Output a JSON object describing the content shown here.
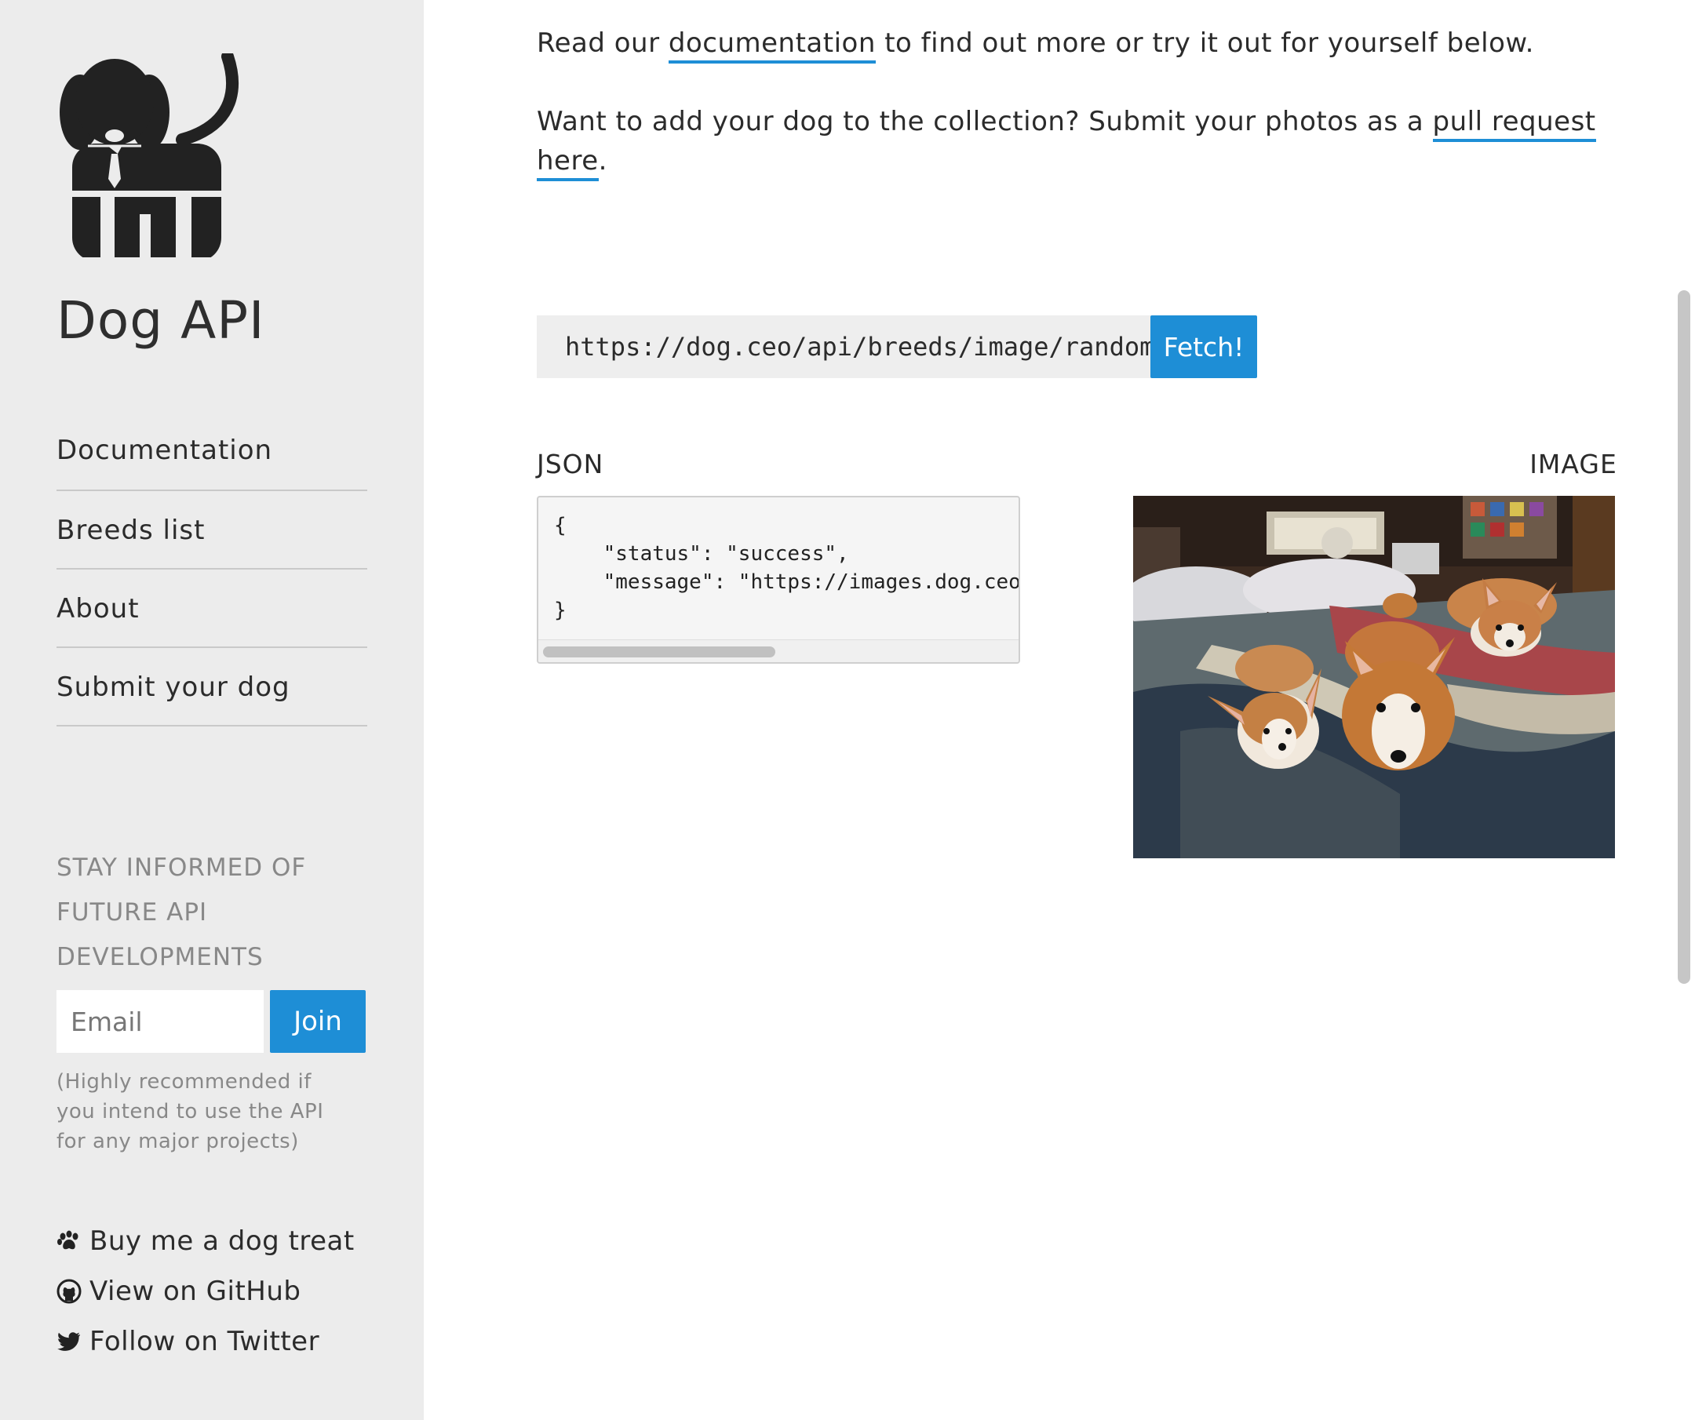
{
  "sidebar": {
    "site_title": "Dog API",
    "nav": [
      "Documentation",
      "Breeds list",
      "About",
      "Submit your dog"
    ],
    "newsletter_heading": "STAY INFORMED OF FUTURE API DEVELOPMENTS",
    "email_placeholder": "Email",
    "join_label": "Join",
    "newsletter_note": "(Highly recommended if you intend to use the API for any major projects)",
    "footer_links": [
      {
        "label": "Buy me a dog treat",
        "icon": "paw-icon"
      },
      {
        "label": "View on GitHub",
        "icon": "github-icon"
      },
      {
        "label": "Follow on Twitter",
        "icon": "twitter-icon"
      }
    ]
  },
  "main": {
    "intro": {
      "prefix": "Read our ",
      "link": "documentation",
      "suffix": " to find out more or try it out for yourself below."
    },
    "submit": {
      "prefix": "Want to add your dog to the collection? Submit your photos as a ",
      "link": "pull request here",
      "suffix": "."
    },
    "endpoint_value": "https://dog.ceo/api/breeds/image/random",
    "fetch_label": "Fetch!",
    "json_label": "JSON",
    "image_label": "IMAGE",
    "json_text": "{\n    \"status\": \"success\",\n    \"message\": \"https://images.dog.ceo\n}"
  },
  "colors": {
    "accent": "#1e8ed6",
    "sidebar_bg": "#ececec",
    "muted_text": "#888888"
  }
}
